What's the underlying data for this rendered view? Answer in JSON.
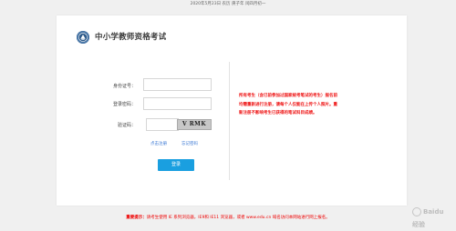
{
  "topbar": {
    "text": "2020年5月23日 农历 庚子年 闰四月初一"
  },
  "site": {
    "title": "中小学教师资格考试"
  },
  "form": {
    "id_label": "身份证号：",
    "password_label": "登录密码：",
    "captcha_label": "验证码：",
    "id_value": "",
    "password_value": "",
    "captcha_value": "",
    "captcha_text": "V RMK",
    "register_link": "点击注册",
    "forgot_link": "忘记密码",
    "login_button": "登录"
  },
  "notice": {
    "text": "所有考生（含已前参加过国家统考笔试的考生）报名前均需重新进行注册，请每个人仅能在上传个人照片。重新注册不影响考生已获得的笔试科目成绩。"
  },
  "footer": {
    "prefix": "重要提示：",
    "text": "请考生使用 IE 系列浏览器，IE9和 IE11 浏览器，或者 www.edu.cn 域名访问本网站进行网上报名。"
  },
  "watermark": {
    "text": "Baidu 经验"
  },
  "colors": {
    "accent": "#1a9fe0",
    "notice": "#ee1111",
    "logo": "#2d5a8a"
  }
}
